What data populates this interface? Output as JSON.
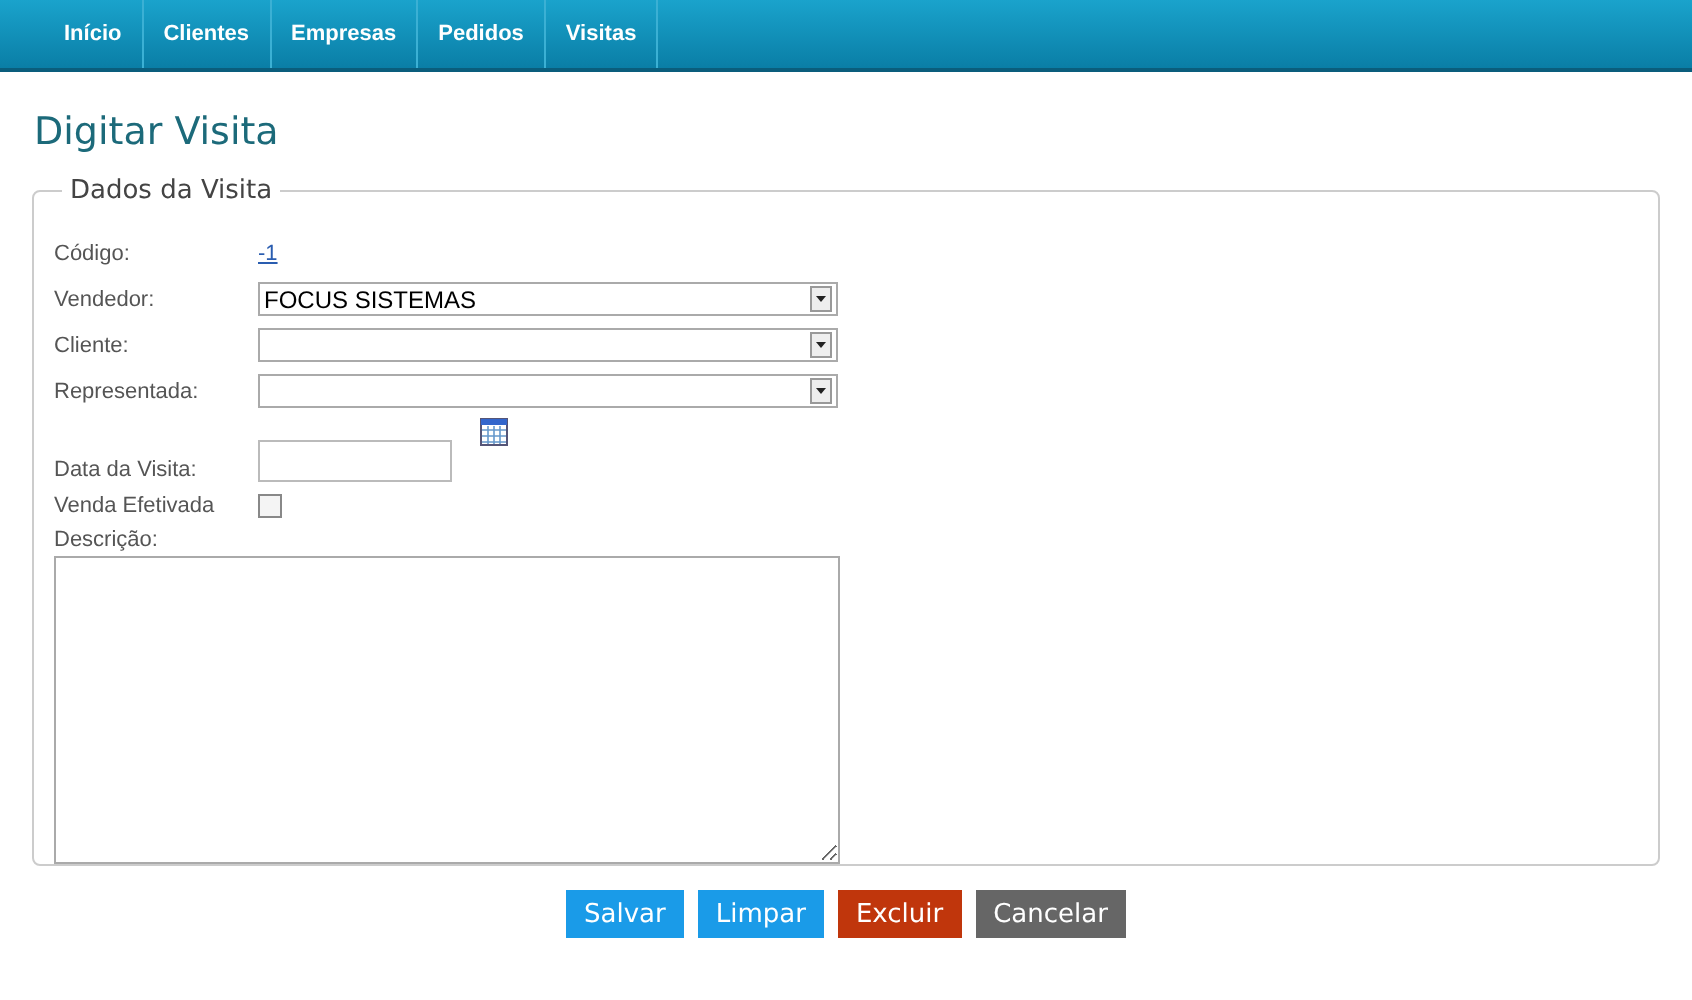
{
  "nav": [
    {
      "label": "Início"
    },
    {
      "label": "Clientes"
    },
    {
      "label": "Empresas"
    },
    {
      "label": "Pedidos"
    },
    {
      "label": "Visitas"
    }
  ],
  "title": "Digitar Visita",
  "fieldset": {
    "legend": "Dados da Visita",
    "fields": [
      {
        "kind": "link",
        "label": "Código:",
        "value": "-1"
      },
      {
        "kind": "select",
        "label": "Vendedor:",
        "value": "FOCUS SISTEMAS"
      },
      {
        "kind": "select",
        "label": "Cliente:"
      },
      {
        "kind": "select",
        "label": "Representada:"
      },
      {
        "kind": "date",
        "label": "Data da Visita:"
      },
      {
        "kind": "checkbox",
        "label": "Venda Efetivada",
        "checked": false
      },
      {
        "kind": "textarea",
        "label": "Descrição:"
      }
    ]
  },
  "buttons": [
    {
      "label": "Salvar",
      "kind": "primary"
    },
    {
      "label": "Limpar",
      "kind": "primary"
    },
    {
      "label": "Excluir",
      "kind": "danger"
    },
    {
      "label": "Cancelar",
      "kind": "neutral"
    }
  ]
}
